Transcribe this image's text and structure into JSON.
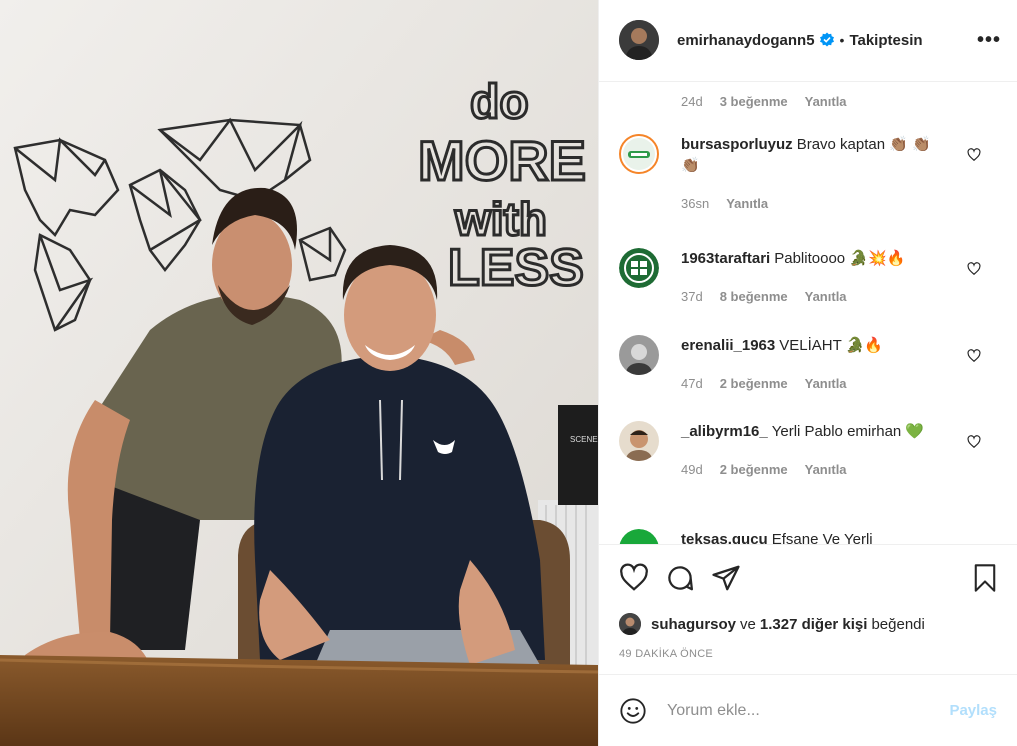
{
  "header": {
    "username": "emirhanaydogann5",
    "separator": "•",
    "follow_label": "Takiptesin",
    "more_label": "•••"
  },
  "top_meta": {
    "time": "24d",
    "likes": "3 beğenme",
    "reply": "Yanıtla"
  },
  "comments": [
    {
      "user": "bursasporluyuz",
      "text": "Bravo kaptan 👏🏽 👏🏽👏🏽",
      "time": "36sn",
      "likes": "",
      "reply": "Yanıtla"
    },
    {
      "user": "1963taraftari",
      "text": "Pablitoooo 🐊💥🔥",
      "time": "37d",
      "likes": "8 beğenme",
      "reply": "Yanıtla"
    },
    {
      "user": "erenalii_1963",
      "text": "VELİAHT 🐊🔥",
      "time": "47d",
      "likes": "2 beğenme",
      "reply": "Yanıtla"
    },
    {
      "user": "_alibyrm16_",
      "text": "Yerli Pablo emirhan 💚",
      "time": "49d",
      "likes": "2 beğenme",
      "reply": "Yanıtla"
    },
    {
      "user": "teksas.gucu",
      "text": "Efsane Ve Yerli"
    }
  ],
  "likes": {
    "user": "suhagursoy",
    "connector": "ve",
    "others": "1.327 diğer kişi",
    "suffix": "beğendi"
  },
  "timestamp": "49 DAKİKA ÖNCE",
  "add_comment": {
    "placeholder": "Yorum ekle...",
    "post_label": "Paylaş"
  },
  "photo": {
    "wall_text": [
      "do",
      "MORE",
      "with",
      "LESS"
    ],
    "clapper_text": "SCENE"
  },
  "colors": {
    "verified": "#0095f6",
    "post_disabled": "#b2dffc",
    "muted": "#8e8e8e",
    "text": "#262626"
  }
}
